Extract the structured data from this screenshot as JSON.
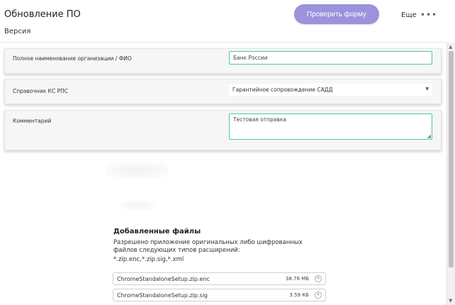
{
  "header": {
    "title": "Обновление ПО",
    "subtitle": "Версия",
    "check_button": "Проверить форму",
    "more_label": "Еще",
    "more_dots": "•••"
  },
  "form": {
    "org_label": "Полное наименование организации / ФИО",
    "org_value": "Банк России",
    "ref_label": "Справочник КС РПС",
    "ref_value": "Гарантийное сопровождение САДД",
    "comment_label": "Комментарий",
    "comment_value": "Тестовая отправка"
  },
  "files": {
    "title": "Добавленные файлы",
    "description": "Разрешено приложение оригинальных либо шифрованных файлов следующих типов расширений:",
    "extensions": "*.zip.enc,*.zip.sig,*.xml",
    "items": [
      {
        "name": "ChromeStandaloneSetup.zip.enc",
        "size": "38.78 МБ"
      },
      {
        "name": "ChromeStandaloneSetup.zip.sig",
        "size": "3.59 КБ"
      }
    ]
  },
  "icons": {
    "dropdown": "▼",
    "remove": "✕",
    "scroll_up": "▲",
    "scroll_down": "▼",
    "resize": "◢"
  }
}
